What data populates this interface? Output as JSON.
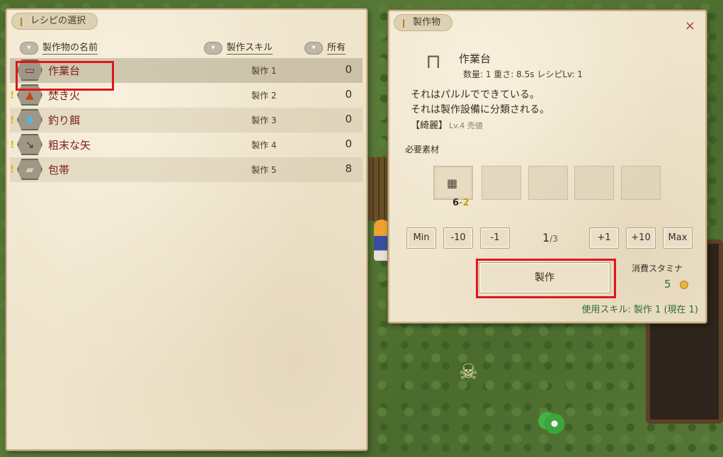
{
  "recipe_panel": {
    "title": "レシピの選択",
    "headers": {
      "name": "製作物の名前",
      "skill": "製作スキル",
      "owned": "所有"
    },
    "recipes": [
      {
        "name": "作業台",
        "skill": "製作 1",
        "owned": "0",
        "icon": "workbench-icon",
        "warning": false
      },
      {
        "name": "焚き火",
        "skill": "製作 2",
        "owned": "0",
        "icon": "campfire-icon",
        "warning": true
      },
      {
        "name": "釣り餌",
        "skill": "製作 3",
        "owned": "0",
        "icon": "bait-icon",
        "warning": true
      },
      {
        "name": "粗末な矢",
        "skill": "製作 4",
        "owned": "0",
        "icon": "arrow-icon",
        "warning": true
      },
      {
        "name": "包帯",
        "skill": "製作 5",
        "owned": "8",
        "icon": "bandage-icon",
        "warning": true
      }
    ]
  },
  "item_panel": {
    "title": "製作物",
    "close": "×",
    "item_name": "作業台",
    "meta": "数量: 1  重さ: 8.5s  レシピLv: 1",
    "desc_line1": "それはパルルでできている。",
    "desc_line2": "それは製作設備に分類される。",
    "quality": "【綺麗】",
    "quality_sub": "Lv.4 売値",
    "required_label": "必要素材",
    "material": {
      "icon": "lumber-icon",
      "have": "6",
      "need": "-2"
    },
    "qty_buttons": [
      "Min",
      "-10",
      "-1",
      "+1",
      "+10",
      "Max"
    ],
    "page_current": "1",
    "page_total": "/3",
    "craft_label": "製作",
    "stamina_label": "消費スタミナ",
    "stamina_value": "5",
    "skill_used": "使用スキル: 製作 1 (現在 1)"
  },
  "colors": {
    "accent_red": "#e0161c",
    "name_red": "#7a1f1a",
    "skill_green": "#2f6b3a"
  }
}
